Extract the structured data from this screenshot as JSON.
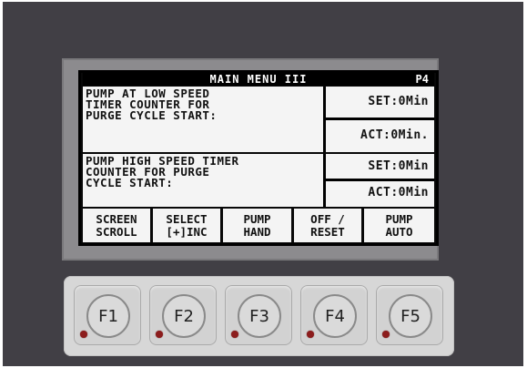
{
  "screen": {
    "title": "MAIN MENU III",
    "page": "P4"
  },
  "panels": [
    {
      "lines": [
        "PUMP AT LOW SPEED",
        "TIMER COUNTER FOR",
        "PURGE CYCLE START:"
      ],
      "set": "SET:0Min",
      "act": "ACT:0Min."
    },
    {
      "lines": [
        "PUMP HIGH SPEED TIMER",
        "COUNTER FOR PURGE",
        "CYCLE START:"
      ],
      "set": "SET:0Min",
      "act": "ACT:0Min"
    }
  ],
  "softkeys": [
    {
      "line1": "SCREEN",
      "line2": "SCROLL"
    },
    {
      "line1": "SELECT",
      "line2": "[+]INC"
    },
    {
      "line1": "PUMP",
      "line2": "HAND"
    },
    {
      "line1": "OFF /",
      "line2": "RESET"
    },
    {
      "line1": "PUMP",
      "line2": "AUTO"
    }
  ],
  "function_keys": [
    "F1",
    "F2",
    "F3",
    "F4",
    "F5"
  ],
  "colors": {
    "housing": "#413f45",
    "lcd_background": "#080808",
    "lcd_foreground": "#f4f4f4",
    "led": "#8c1d1d"
  }
}
